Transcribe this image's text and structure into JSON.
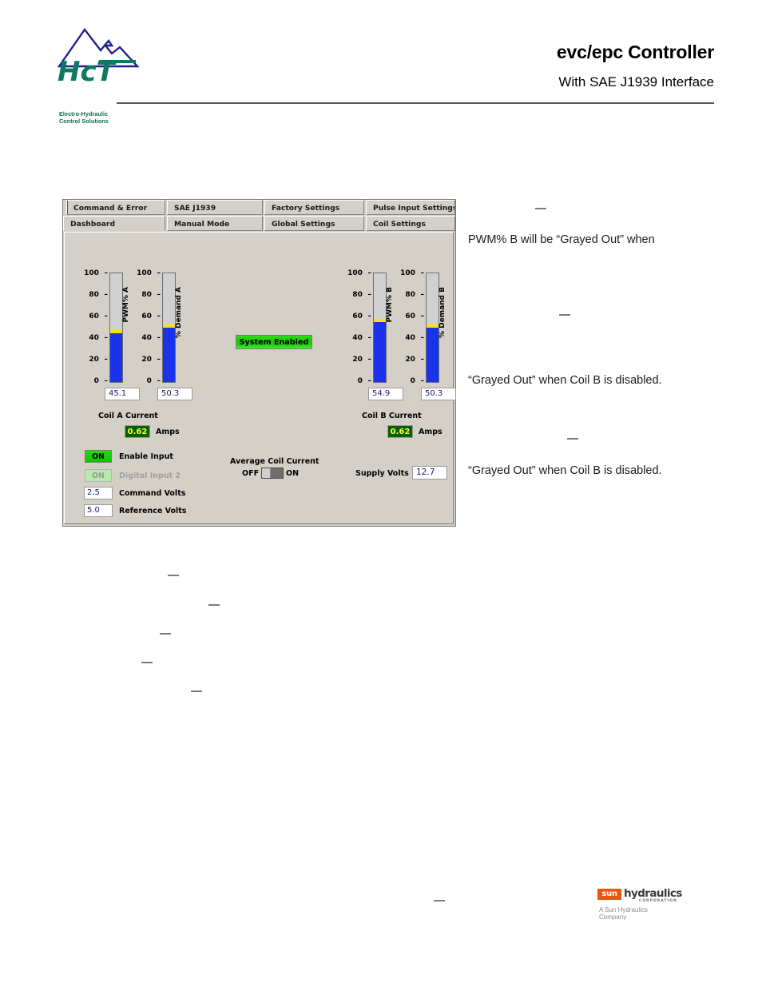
{
  "header": {
    "title": "evc/epc Controller",
    "subtitle": "With SAE J1939 Interface",
    "logo_tag_line1": "Electro-Hydraulic",
    "logo_tag_line2": "Control Solutions",
    "logo_text": "HcT"
  },
  "app": {
    "tabs_row_top": [
      {
        "label": "Command & Error"
      },
      {
        "label": "SAE J1939"
      },
      {
        "label": "Factory Settings"
      },
      {
        "label": "Pulse Input Settings"
      }
    ],
    "tabs_row_bottom": [
      {
        "label": "Dashboard",
        "active": true
      },
      {
        "label": "Manual Mode"
      },
      {
        "label": "Global Settings"
      },
      {
        "label": "Coil Settings"
      }
    ],
    "status_button": "System Enabled",
    "gauges": [
      {
        "label": "PWM% A",
        "value": "45.1",
        "value_num": 45.1
      },
      {
        "label": "% Demand A",
        "value": "50.3",
        "value_num": 50.3
      },
      {
        "label": "PWM% B",
        "value": "54.9",
        "value_num": 54.9
      },
      {
        "label": "% Demand B",
        "value": "50.3",
        "value_num": 50.3
      }
    ],
    "gauge_ticks": [
      "100",
      "80",
      "60",
      "40",
      "20",
      "0"
    ],
    "coil_a": {
      "caption": "Coil A Current",
      "amps": "0.62",
      "units": "Amps"
    },
    "coil_b": {
      "caption": "Coil B Current",
      "amps": "0.62",
      "units": "Amps"
    },
    "indicators": [
      {
        "state": "ON",
        "label": "Enable Input",
        "enabled": true
      },
      {
        "state": "ON",
        "label": "Digital Input 2",
        "enabled": false
      }
    ],
    "fields": [
      {
        "value": "2.5",
        "label": "Command Volts"
      },
      {
        "value": "5.0",
        "label": "Reference Volts"
      }
    ],
    "average_coil_current": {
      "title": "Average Coil Current",
      "off_label": "OFF",
      "on_label": "ON",
      "position": "OFF"
    },
    "supply": {
      "label": "Supply Volts",
      "value": "12.7"
    },
    "colors": {
      "panel": "#d4d0c8",
      "bar_fill": "#1a32e8",
      "bar_marker": "#ffe200",
      "led_on": "#18c408",
      "amps_bg": "#036103",
      "amps_text": "#ffff2b"
    }
  },
  "body_text": {
    "line1": "PWM% B will be “Grayed Out” when",
    "line2": "“Grayed Out” when Coil B is disabled.",
    "line3": "“Grayed Out” when Coil B is disabled."
  },
  "footer": {
    "brand_badge": "sun",
    "brand_word": "hydraulics",
    "brand_corp": "CORPORATION",
    "brand_tag": "A Sun Hydraulics Company"
  }
}
